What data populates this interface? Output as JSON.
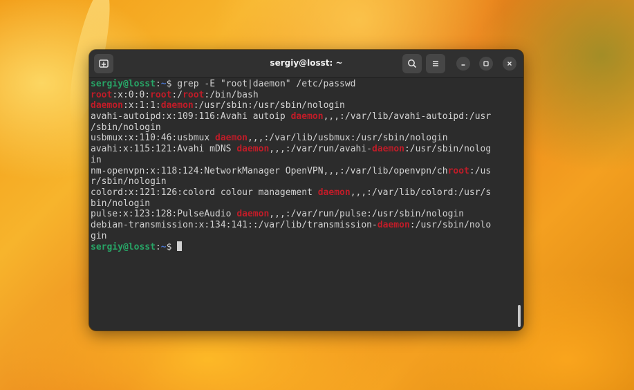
{
  "window": {
    "title": "sergiy@losst: ~",
    "buttons": {
      "new_tab_icon": "new-tab-icon",
      "search_icon": "search-icon",
      "menu_icon": "hamburger-menu-icon",
      "minimize_icon": "minimize-icon",
      "maximize_icon": "maximize-icon",
      "close_icon": "close-icon"
    }
  },
  "colors": {
    "prompt_user": "#27a566",
    "prompt_path": "#4a73c9",
    "match_highlight": "#c01c28",
    "terminal_bg": "#2c2c2c",
    "terminal_fg": "#d2d2d2"
  },
  "terminal": {
    "lines": [
      [
        {
          "t": "sergiy@losst",
          "c": "user"
        },
        {
          "t": ":",
          "c": ""
        },
        {
          "t": "~",
          "c": "path"
        },
        {
          "t": "$ grep -E \"root|daemon\" /etc/passwd",
          "c": ""
        }
      ],
      [
        {
          "t": "root",
          "c": "hl"
        },
        {
          "t": ":x:0:0:",
          "c": ""
        },
        {
          "t": "root",
          "c": "hl"
        },
        {
          "t": ":/",
          "c": ""
        },
        {
          "t": "root",
          "c": "hl"
        },
        {
          "t": ":/bin/bash",
          "c": ""
        }
      ],
      [
        {
          "t": "daemon",
          "c": "hl"
        },
        {
          "t": ":x:1:1:",
          "c": ""
        },
        {
          "t": "daemon",
          "c": "hl"
        },
        {
          "t": ":/usr/sbin:/usr/sbin/nologin",
          "c": ""
        }
      ],
      [
        {
          "t": "avahi-autoipd:x:109:116:Avahi autoip ",
          "c": ""
        },
        {
          "t": "daemon",
          "c": "hl"
        },
        {
          "t": ",,,:/var/lib/avahi-autoipd:/usr",
          "c": ""
        }
      ],
      [
        {
          "t": "/sbin/nologin",
          "c": ""
        }
      ],
      [
        {
          "t": "usbmux:x:110:46:usbmux ",
          "c": ""
        },
        {
          "t": "daemon",
          "c": "hl"
        },
        {
          "t": ",,,:/var/lib/usbmux:/usr/sbin/nologin",
          "c": ""
        }
      ],
      [
        {
          "t": "avahi:x:115:121:Avahi mDNS ",
          "c": ""
        },
        {
          "t": "daemon",
          "c": "hl"
        },
        {
          "t": ",,,:/var/run/avahi-",
          "c": ""
        },
        {
          "t": "daemon",
          "c": "hl"
        },
        {
          "t": ":/usr/sbin/nolog",
          "c": ""
        }
      ],
      [
        {
          "t": "in",
          "c": ""
        }
      ],
      [
        {
          "t": "nm-openvpn:x:118:124:NetworkManager OpenVPN,,,:/var/lib/openvpn/ch",
          "c": ""
        },
        {
          "t": "root",
          "c": "hl"
        },
        {
          "t": ":/us",
          "c": ""
        }
      ],
      [
        {
          "t": "r/sbin/nologin",
          "c": ""
        }
      ],
      [
        {
          "t": "colord:x:121:126:colord colour management ",
          "c": ""
        },
        {
          "t": "daemon",
          "c": "hl"
        },
        {
          "t": ",,,:/var/lib/colord:/usr/s",
          "c": ""
        }
      ],
      [
        {
          "t": "bin/nologin",
          "c": ""
        }
      ],
      [
        {
          "t": "pulse:x:123:128:PulseAudio ",
          "c": ""
        },
        {
          "t": "daemon",
          "c": "hl"
        },
        {
          "t": ",,,:/var/run/pulse:/usr/sbin/nologin",
          "c": ""
        }
      ],
      [
        {
          "t": "debian-transmission:x:134:141::/var/lib/transmission-",
          "c": ""
        },
        {
          "t": "daemon",
          "c": "hl"
        },
        {
          "t": ":/usr/sbin/nolo",
          "c": ""
        }
      ],
      [
        {
          "t": "gin",
          "c": ""
        }
      ],
      [
        {
          "t": "sergiy@losst",
          "c": "user"
        },
        {
          "t": ":",
          "c": ""
        },
        {
          "t": "~",
          "c": "path"
        },
        {
          "t": "$ ",
          "c": ""
        },
        {
          "t": "",
          "c": "cursor"
        }
      ]
    ]
  }
}
